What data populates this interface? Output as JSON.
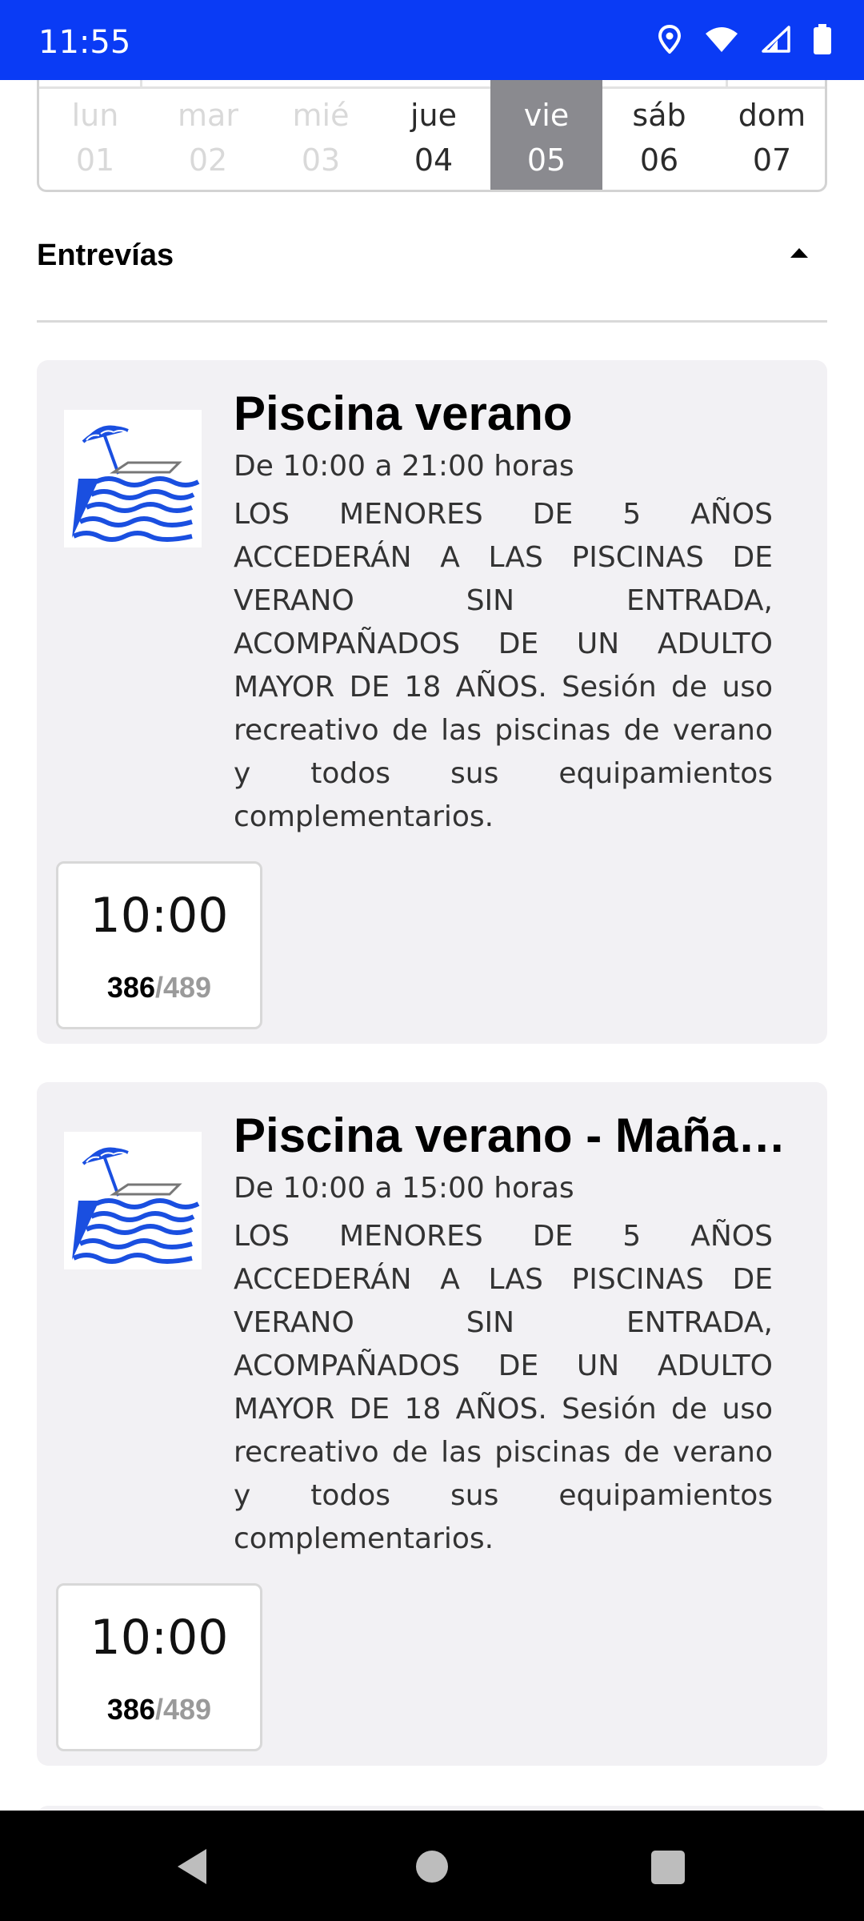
{
  "status_bar": {
    "time": "11:55",
    "icons": [
      "location-icon",
      "wifi-icon",
      "signal-icon",
      "battery-icon"
    ],
    "background": "#0a3bf5"
  },
  "days": [
    {
      "name": "lun",
      "num": "01",
      "state": "disabled"
    },
    {
      "name": "mar",
      "num": "02",
      "state": "disabled"
    },
    {
      "name": "mié",
      "num": "03",
      "state": "disabled"
    },
    {
      "name": "jue",
      "num": "04",
      "state": "enabled"
    },
    {
      "name": "vie",
      "num": "05",
      "state": "selected"
    },
    {
      "name": "sáb",
      "num": "06",
      "state": "enabled"
    },
    {
      "name": "dom",
      "num": "07",
      "state": "enabled"
    }
  ],
  "section": {
    "title": "Entrevías",
    "expanded": true
  },
  "activities": [
    {
      "icon": "beach-umbrella-waves-icon",
      "title": "Piscina verano",
      "hours": "De 10:00 a 21:00 horas",
      "description": "LOS MENORES DE 5 AÑOS ACCEDERÁN A LAS PISCINAS DE VERANO SIN ENTRADA, ACOMPAÑADOS DE UN ADULTO MAYOR DE 18 AÑOS. Sesión de uso recreativo de las piscinas de verano y todos sus equipamientos complementarios.",
      "slot": {
        "time": "10:00",
        "available": "386",
        "separator": "/",
        "capacity": "489"
      }
    },
    {
      "icon": "beach-umbrella-waves-icon",
      "title": "Piscina verano - Mañana",
      "hours": "De 10:00 a 15:00 horas",
      "description": "LOS MENORES DE 5 AÑOS ACCEDERÁN A LAS PISCINAS DE VERANO SIN ENTRADA, ACOMPAÑADOS DE UN ADULTO MAYOR DE 18 AÑOS. Sesión de uso recreativo de las piscinas de verano y todos sus equipamientos complementarios.",
      "slot": {
        "time": "10:00",
        "available": "386",
        "separator": "/",
        "capacity": "489"
      }
    }
  ],
  "nav_bar": {
    "buttons": [
      "back-icon",
      "home-icon",
      "recents-icon"
    ]
  },
  "colors": {
    "accent": "#0a3bf5",
    "selected_day": "#8a8a8f",
    "card_background": "#f2f1f4",
    "icon_blue": "#1a4fe0"
  }
}
